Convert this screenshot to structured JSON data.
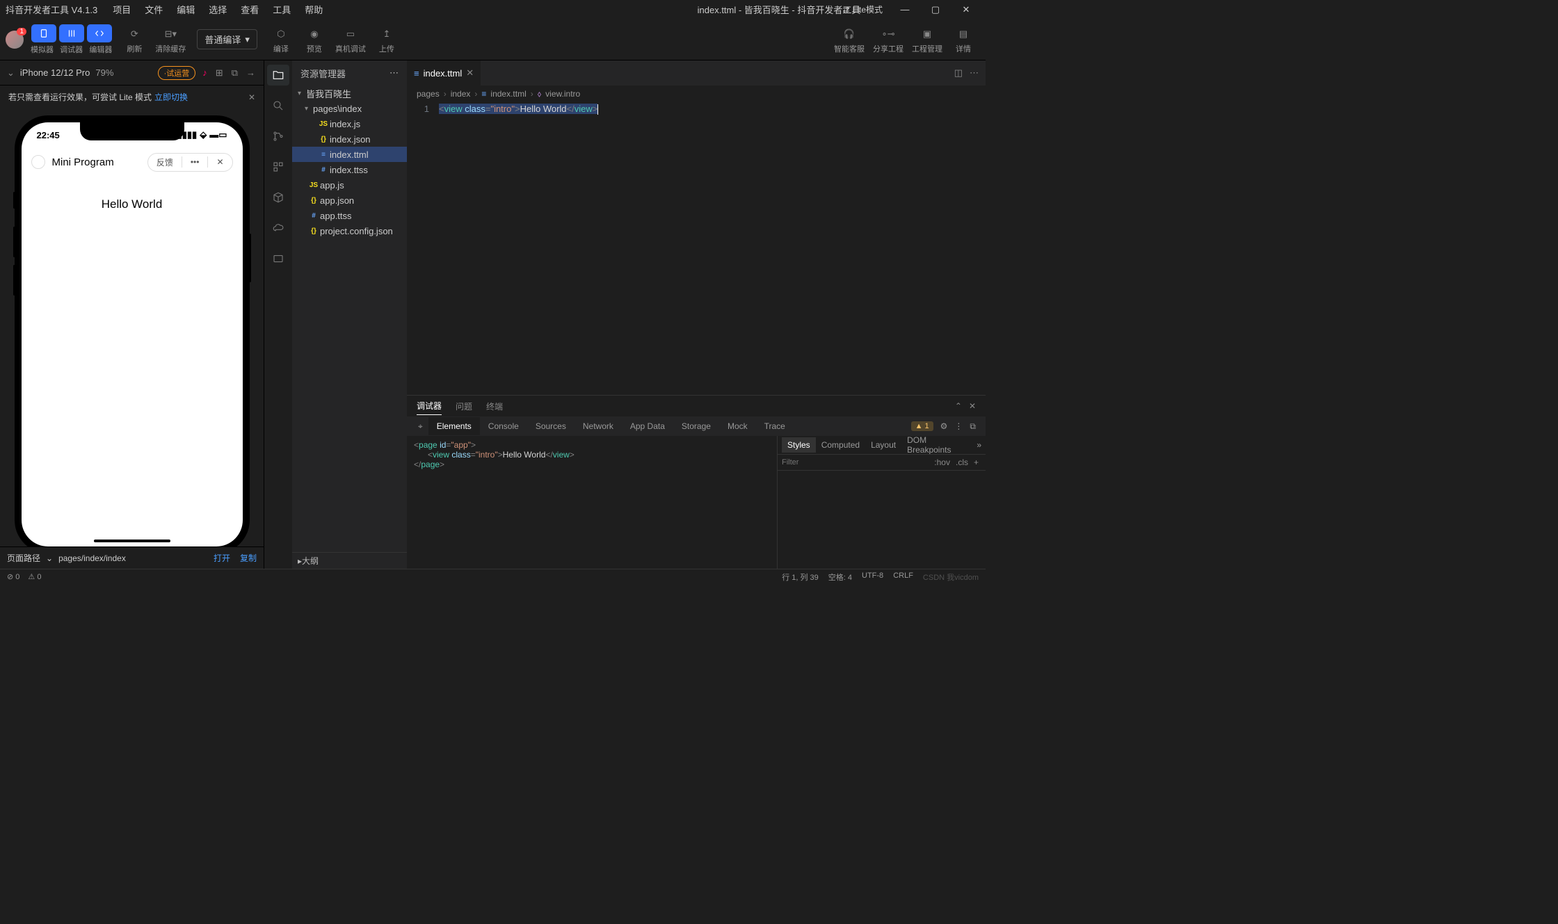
{
  "titlebar": {
    "app": "抖音开发者工具 V4.1.3",
    "menus": [
      "项目",
      "文件",
      "编辑",
      "选择",
      "查看",
      "工具",
      "帮助"
    ],
    "center": "index.ttml - 皆我百晓生 - 抖音开发者工具",
    "lite_mode": "Lite模式"
  },
  "avatar_badge": "1",
  "toolbar": {
    "groups": [
      {
        "labels": "模拟器   调试器   编辑器"
      },
      {
        "label": "刷新"
      },
      {
        "label": "清除缓存"
      }
    ],
    "compile_mode": "普通编译",
    "actions": [
      {
        "label": "编译"
      },
      {
        "label": "预览"
      },
      {
        "label": "真机调试"
      },
      {
        "label": "上传"
      }
    ],
    "right": [
      {
        "label": "智能客服"
      },
      {
        "label": "分享工程"
      },
      {
        "label": "工程管理"
      },
      {
        "label": "详情"
      }
    ]
  },
  "simulator": {
    "device": "iPhone 12/12 Pro",
    "zoom": "79%",
    "trial": "·试运营",
    "tip": "若只需查看运行效果，可尝试 Lite 模式",
    "tip_link": "立即切换",
    "status_time": "22:45",
    "mp_title": "Mini Program",
    "feedback": "反馈",
    "content": "Hello World",
    "footer_label": "页面路径",
    "footer_path": "pages/index/index",
    "open": "打开",
    "copy": "复制"
  },
  "explorer": {
    "title": "资源管理器",
    "root": "皆我百晓生",
    "folder": "pages\\index",
    "files_index": [
      "index.js",
      "index.json",
      "index.ttml",
      "index.ttss"
    ],
    "files_root": [
      "app.js",
      "app.json",
      "app.ttss",
      "project.config.json"
    ],
    "outline": "大纲"
  },
  "editor": {
    "tab": "index.ttml",
    "breadcrumb": [
      "pages",
      "index",
      "index.ttml",
      "view.intro"
    ],
    "line_no": "1",
    "code": {
      "t1": "<",
      "tag1": "view",
      "sp": " ",
      "attr": "class",
      "eq": "=",
      "str": "\"intro\"",
      "t2": ">",
      "txt": "Hello World",
      "t3": "</",
      "tag2": "view",
      "t4": ">"
    }
  },
  "bottom": {
    "tabs": [
      "调试器",
      "问题",
      "终端"
    ],
    "dt_tabs": [
      "Elements",
      "Console",
      "Sources",
      "Network",
      "App Data",
      "Storage",
      "Mock",
      "Trace"
    ],
    "warn": "1",
    "elements": {
      "l1_open": "<page id=\"app\">",
      "l2": "<view class=\"intro\">Hello World</view>",
      "l1_close": "</page>"
    },
    "styles_tabs": [
      "Styles",
      "Computed",
      "Layout",
      "DOM Breakpoints"
    ],
    "filter_ph": "Filter",
    "hov": ":hov",
    "cls": ".cls"
  },
  "statusbar": {
    "err": "0",
    "warn": "0",
    "pos": "行 1, 列 39",
    "spaces": "空格: 4",
    "enc": "UTF-8",
    "eol": "CRLF",
    "watermark": "CSDN 我vicdom"
  }
}
